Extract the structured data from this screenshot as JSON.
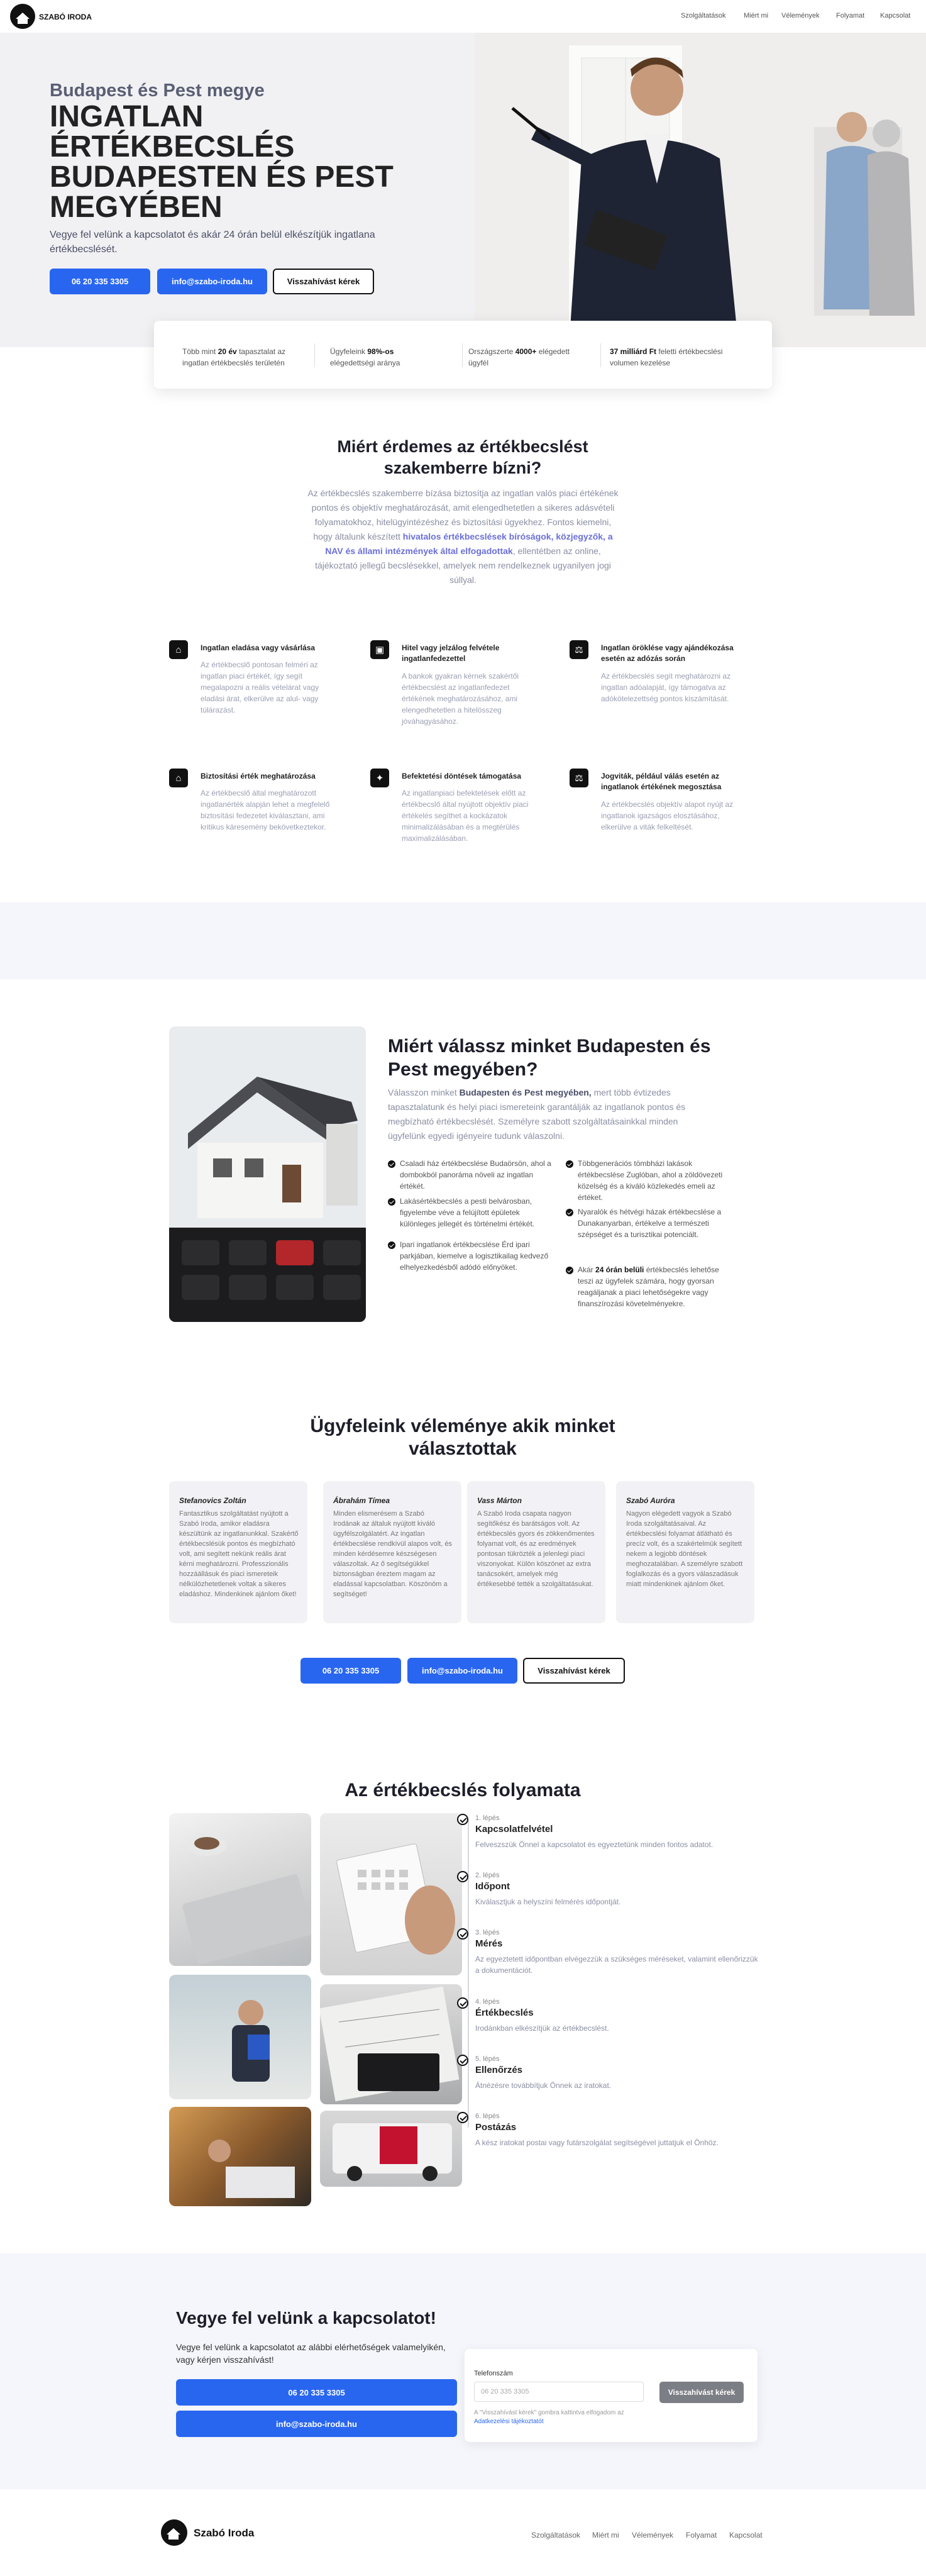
{
  "brand": {
    "name": "SZABÓ IRODA",
    "footer_name": "Szabó Iroda"
  },
  "nav": {
    "items": [
      "Szolgáltatások",
      "Miért mi",
      "Vélemények",
      "Folyamat",
      "Kapcsolat"
    ]
  },
  "hero": {
    "subtitle": "Budapest és Pest megye",
    "title": "INGATLAN ÉRTÉKBECSLÉS BUDAPESTEN ÉS PEST MEGYÉBEN",
    "description": "Vegye fel velünk a kapcsolatot és akár 24 órán belül elkészítjük ingatlana értékbecslését.",
    "phone_button": "06 20 335 3305",
    "email_button": "info@szabo-iroda.hu",
    "callback_button": "Visszahívást kérek"
  },
  "stats": [
    {
      "pre": "Több mint ",
      "bold": "20 év",
      "post": " tapasztalat az ingatlan értékbecslés területén"
    },
    {
      "pre": "Ügyfeleink ",
      "bold": "98%-os",
      "post": " elégedettségi aránya"
    },
    {
      "pre": "Országszerte ",
      "bold": "4000+",
      "post": " elégedett ügyfél"
    },
    {
      "pre": "",
      "bold": "37 milliárd Ft",
      "post": " feletti értékbecslési volumen kezelése"
    }
  ],
  "why_expert": {
    "title": "Miért érdemes az értékbecslést szakemberre bízni?",
    "text_pre": "Az értékbecslés szakemberre bízása biztosítja az ingatlan valós piaci értékének pontos és objektív meghatározását, amit elengedhetetlen a sikeres adásvételi folyamatokhoz, hitelügyintézéshez és biztosítási ügyekhez. Fontos kiemelni, hogy általunk készített ",
    "text_bold": "hivatalos értékbecslések bíróságok, közjegyzők, a NAV és állami intézmények által elfogadottak",
    "text_post": ", ellentétben az online, tájékoztató jellegű becslésekkel, amelyek nem rendelkeznek ugyanilyen jogi súllyal."
  },
  "features": [
    {
      "icon": "home-icon",
      "glyph": "⌂",
      "title": "Ingatlan eladása vagy vásárlása",
      "text": "Az értékbecslő pontosan felméri az ingatlan piaci értékét, így segít megalapozni a reális vételárat vagy eladási árat, elkerülve az alul- vagy túlárazást."
    },
    {
      "icon": "bank-icon",
      "glyph": "▣",
      "title": "Hitel vagy jelzálog felvétele ingatlanfedezettel",
      "text": "A bankok gyakran kérnek szakértői értékbecslést az ingatlanfedezet értékének meghatározásához, ami elengedhetetlen a hitelösszeg jóváhagyásához."
    },
    {
      "icon": "scale-icon",
      "glyph": "⚖",
      "title": "Ingatlan öröklése vagy ajándékozása esetén az adózás során",
      "text": "Az értékbecslés segít meghatározni az ingatlan adóalapját, így támogatva az adókötelezettség pontos kiszámítását."
    },
    {
      "icon": "house-icon",
      "glyph": "⌂",
      "title": "Biztosítási érték meghatározása",
      "text": "Az értékbecslő által meghatározott ingatlanérték alapján lehet a megfelelő biztosítási fedezetet kiválasztani, ami kritikus káresemény bekövetkeztekor."
    },
    {
      "icon": "handshake-icon",
      "glyph": "✦",
      "title": "Befektetési döntések támogatása",
      "text": "Az ingatlanpiaci befektetések előtt az értékbecslő által nyújtott objektív piaci értékelés segíthet a kockázatok minimalizálásában és a megtérülés maximalizálásában."
    },
    {
      "icon": "gavel-icon",
      "glyph": "⚖",
      "title": "Jogviták, például válás esetén az ingatlanok értékének megosztása",
      "text": "Az értékbecslés objektív alapot nyújt az ingatlanok igazságos elosztásához, elkerülve a viták felkeltését."
    }
  ],
  "why_us": {
    "title": "Miért válassz minket Budapesten és Pest megyében?",
    "intro_pre": "Válasszon minket ",
    "intro_bold": "Budapesten és Pest megyében,",
    "intro_post": " mert több évtizedes tapasztalatunk és helyi piaci ismereteink garantálják az ingatlanok pontos és megbízható értékbecslését. Személyre szabott szolgáltatásainkkal minden ügyfelünk egyedi igényeire tudunk válaszolni.",
    "bullets_left": [
      "Csaladi ház értékbecslése Budaörsön, ahol a dombokból panoráma növeli az ingatlan értékét.",
      "Lakásértékbecslés a pesti belvárosban, figyelembe véve a felújított épületek különleges jellegét és történelmi értékét.",
      "Ipari ingatlanok értékbecslése Érd ipari parkjában, kiemelve a logisztikailag kedvező elhelyezkedésből adódó előnyöket."
    ],
    "bullets_right": [
      "Többgenerációs tömbházi lakások értékbecslése Zuglóban, ahol a zöldövezeti közelség és a kiváló közlekedés emeli az értéket.",
      "Nyaralók és hétvégi házak értékbecslése a Dunakanyarban, értékelve a természeti szépséget és a turisztikai potenciált.",
      {
        "pre": "Akár ",
        "bold": "24 órán belüli",
        "post": " értékbecslés lehetőse teszi az ügyfelek számára, hogy gyorsan reagáljanak a piaci lehetőségekre vagy finanszírozási követelményekre."
      }
    ]
  },
  "reviews": {
    "title": "Ügyfeleink véleménye akik minket választottak",
    "items": [
      {
        "name": "Stefanovics Zoltán",
        "text": "Fantasztikus szolgáltatást nyújtott a Szabó Iroda, amikor eladásra készültünk az ingatlanunkkal. Szakértő értékbecslésük pontos és megbízható volt, ami segített nekünk reális árat kérni meghatározni. Professzionális hozzáállásuk és piaci ismereteik nélkülözhetetlenek voltak a sikeres eladáshoz. Mindenkinek ajánlom őket!"
      },
      {
        "name": "Ábrahám Tímea",
        "text": "Minden elismerésem a Szabó Irodának az általuk nyújtott kiváló ügyfélszolgálatért. Az ingatlan értékbecslése rendkívül alapos volt, és minden kérdésemre készségesen válaszoltak. Az ő segítségükkel biztonságban éreztem magam az eladással kapcsolatban. Köszönöm a segítséget!"
      },
      {
        "name": "Vass Márton",
        "text": "A Szabó Iroda csapata nagyon segítőkész és barátságos volt. Az értékbecslés gyors és zökkenőmentes folyamat volt, és az eredmények pontosan tükrözték a jelenlegi piaci viszonyokat. Külön köszönet az extra tanácsokért, amelyek még értékesebbé tették a szolgáltatásukat."
      },
      {
        "name": "Szabó Auróra",
        "text": "Nagyon elégedett vagyok a Szabó Iroda szolgáltatásaival. Az értékbecslési folyamat átlátható és precíz volt, és a szakértelmük segített nekem a legjobb döntések meghozatalában. A személyre szabott foglalkozás és a gyors válaszadásuk miatt mindenkinek ajánlom őket."
      }
    ]
  },
  "cta": {
    "phone": "06 20 335 3305",
    "email": "info@szabo-iroda.hu",
    "callback": "Visszahívást kérek"
  },
  "process": {
    "title": "Az értékbecslés folyamata",
    "steps": [
      {
        "label": "1. lépés",
        "title": "Kapcsolatfelvétel",
        "desc": "Felveszszük Önnel a kapcsolatot és egyeztetünk minden fontos adatot."
      },
      {
        "label": "2. lépés",
        "title": "Időpont",
        "desc": "Kiválasztjuk a helyszíni felmérés időpontját."
      },
      {
        "label": "3. lépés",
        "title": "Mérés",
        "desc": "Az egyeztetett időpontban elvégezzük a szükséges méréseket, valamint ellenőrizzük a dokumentációt."
      },
      {
        "label": "4. lépés",
        "title": "Értékbecslés",
        "desc": "Irodánkban elkészítjük az értékbecslést."
      },
      {
        "label": "5. lépés",
        "title": "Ellenőrzés",
        "desc": "Átnézésre továbbítjuk Önnek az iratokat."
      },
      {
        "label": "6. lépés",
        "title": "Postázás",
        "desc": "A kész iratokat postai vagy futárszolgálat segítségével juttatjuk el Önhöz."
      }
    ]
  },
  "contact": {
    "title": "Vegye fel velünk a kapcsolatot!",
    "text": "Vegye fel velünk a kapcsolatot az alábbi elérhetőségek valamelyikén, vagy kérjen visszahívást!",
    "phone": "06 20 335 3305",
    "email": "info@szabo-iroda.hu",
    "form_label": "Telefonszám",
    "form_placeholder": "06 20 335 3305",
    "form_button": "Visszahívást kérek",
    "consent_pre": "A \"Visszahívást kérek\" gombra kattintva elfogadom az ",
    "consent_link": "Adatkezelési tájékoztatót"
  },
  "colors": {
    "accent": "#2966f0",
    "dark": "#111111",
    "band": "#f5f6fb"
  }
}
